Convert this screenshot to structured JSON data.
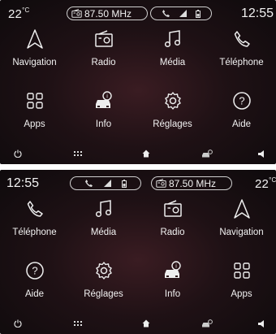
{
  "top_screen": {
    "temperature": "22",
    "temp_unit": "°C",
    "radio_frequency": "87.50 MHz",
    "clock": "12:55",
    "apps": [
      {
        "label": "Navigation",
        "icon": "navigation-arrow-icon"
      },
      {
        "label": "Radio",
        "icon": "radio-icon"
      },
      {
        "label": "Média",
        "icon": "music-note-icon"
      },
      {
        "label": "Téléphone",
        "icon": "phone-icon"
      },
      {
        "label": "Apps",
        "icon": "apps-grid-icon"
      },
      {
        "label": "Info",
        "icon": "car-info-icon"
      },
      {
        "label": "Réglages",
        "icon": "gear-icon"
      },
      {
        "label": "Aide",
        "icon": "help-icon"
      }
    ]
  },
  "bottom_screen": {
    "temperature": "22",
    "temp_unit": "°C",
    "radio_frequency": "87.50 MHz",
    "clock": "12:55",
    "apps": [
      {
        "label": "Téléphone",
        "icon": "phone-icon"
      },
      {
        "label": "Média",
        "icon": "music-note-icon"
      },
      {
        "label": "Radio",
        "icon": "radio-icon"
      },
      {
        "label": "Navigation",
        "icon": "navigation-arrow-icon"
      },
      {
        "label": "Aide",
        "icon": "help-icon"
      },
      {
        "label": "Réglages",
        "icon": "gear-icon"
      },
      {
        "label": "Info",
        "icon": "car-info-icon"
      },
      {
        "label": "Apps",
        "icon": "apps-grid-icon"
      }
    ]
  },
  "dock": [
    "power-icon",
    "app-menu-icon",
    "home-icon",
    "vehicle-settings-icon",
    "volume-icon"
  ],
  "colors": {
    "background": "#1f1115",
    "accent": "#3a1c22",
    "text": "#f2f2f2"
  }
}
